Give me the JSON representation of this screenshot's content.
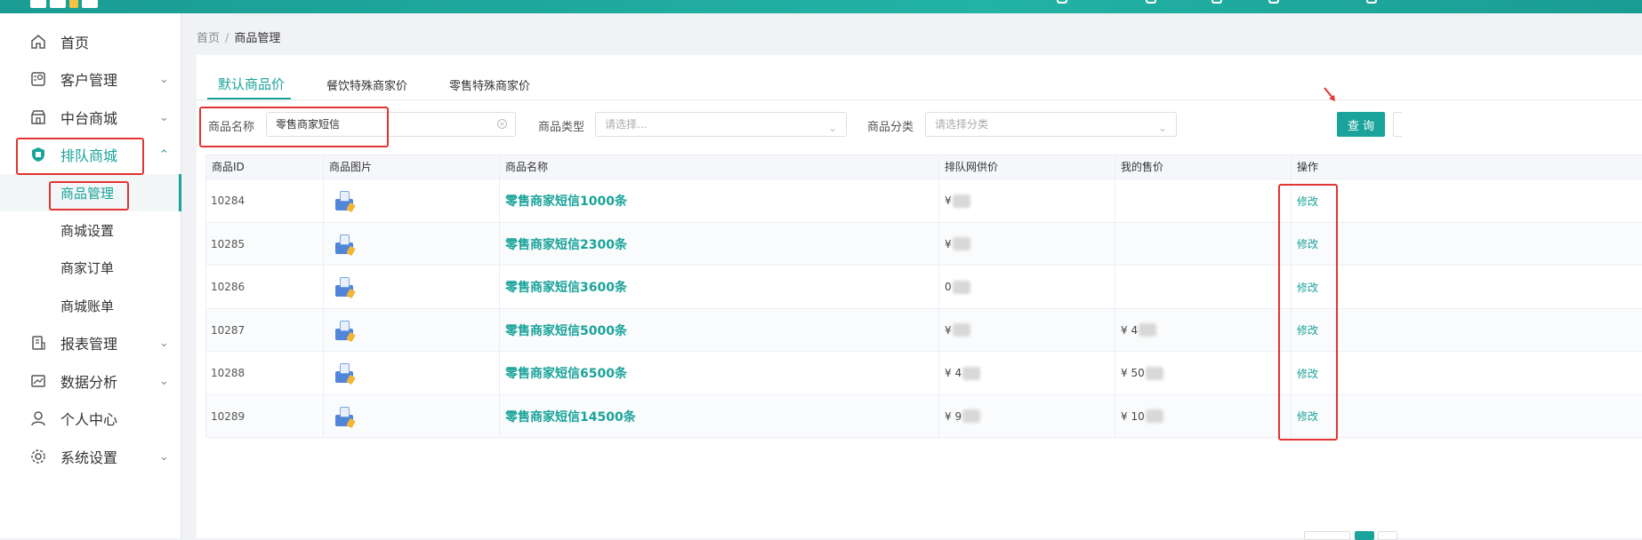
{
  "sidebar": {
    "items": [
      {
        "label": "首页",
        "icon": "home-icon",
        "has_children": false
      },
      {
        "label": "客户管理",
        "icon": "customer-icon",
        "has_children": true
      },
      {
        "label": "中台商城",
        "icon": "store-icon",
        "has_children": true
      },
      {
        "label": "排队商城",
        "icon": "shield-icon",
        "has_children": true,
        "expanded": true
      },
      {
        "label": "报表管理",
        "icon": "report-icon",
        "has_children": true
      },
      {
        "label": "数据分析",
        "icon": "chart-icon",
        "has_children": true
      },
      {
        "label": "个人中心",
        "icon": "user-icon",
        "has_children": false
      },
      {
        "label": "系统设置",
        "icon": "gear-icon",
        "has_children": true
      }
    ],
    "subitems": [
      {
        "label": "商品管理",
        "selected": true
      },
      {
        "label": "商城设置"
      },
      {
        "label": "商家订单"
      },
      {
        "label": "商城账单"
      }
    ]
  },
  "breadcrumb": {
    "home": "首页",
    "separator": "/",
    "current": "商品管理"
  },
  "tabs": [
    {
      "label": "默认商品价",
      "active": true
    },
    {
      "label": "餐饮特殊商家价"
    },
    {
      "label": "零售特殊商家价"
    }
  ],
  "filters": {
    "name_label": "商品名称",
    "name_value": "零售商家短信",
    "type_label": "商品类型",
    "type_placeholder": "请选择...",
    "category_label": "商品分类",
    "category_placeholder": "请选择分类",
    "query_button": "查询"
  },
  "table": {
    "columns": [
      "商品ID",
      "商品图片",
      "商品名称",
      "排队网供价",
      "我的售价",
      "操作"
    ],
    "rows": [
      {
        "id": "10284",
        "name": "零售商家短信1000条",
        "supply_price": "¥",
        "my_price": "",
        "action": "修改"
      },
      {
        "id": "10285",
        "name": "零售商家短信2300条",
        "supply_price": "¥",
        "my_price": "",
        "action": "修改"
      },
      {
        "id": "10286",
        "name": "零售商家短信3600条",
        "supply_price": "0",
        "my_price": "",
        "action": "修改"
      },
      {
        "id": "10287",
        "name": "零售商家短信5000条",
        "supply_price": "¥",
        "my_price": "¥ 4",
        "action": "修改"
      },
      {
        "id": "10288",
        "name": "零售商家短信6500条",
        "supply_price": "¥ 4",
        "my_price": "¥ 50",
        "action": "修改"
      },
      {
        "id": "10289",
        "name": "零售商家短信14500条",
        "supply_price": "¥ 9",
        "my_price": "¥ 10",
        "action": "修改"
      }
    ]
  },
  "colors": {
    "accent": "#1aa39a",
    "highlight_box": "#e53333"
  }
}
